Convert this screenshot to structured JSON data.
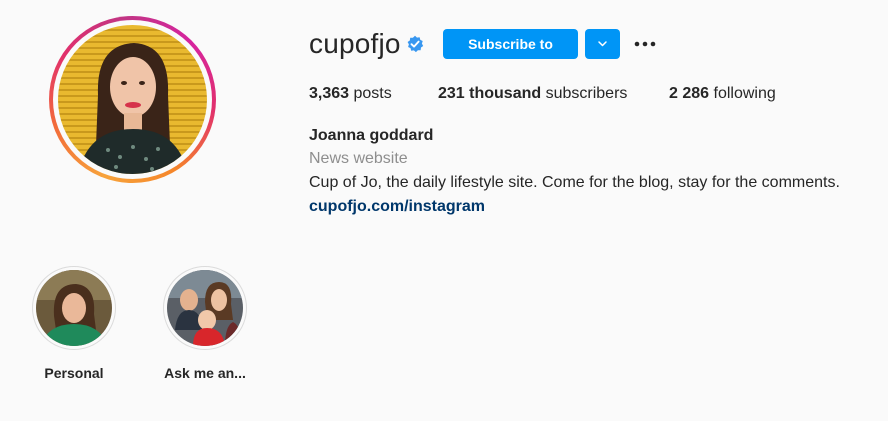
{
  "profile": {
    "username": "cupofjo",
    "verified": true,
    "subscribe_label": "Subscribe to",
    "full_name": "Joanna goddard",
    "category": "News website",
    "bio": "Cup of Jo, the daily lifestyle site. Come for the blog, stay for the comments.",
    "link": "cupofjo.com/instagram"
  },
  "stats": {
    "posts_value": "3,363",
    "posts_label": "posts",
    "subscribers_value": "231 thousand",
    "subscribers_label": "subscribers",
    "following_value": "2 286",
    "following_label": "following"
  },
  "highlights": [
    {
      "label": "Personal"
    },
    {
      "label": "Ask me an..."
    }
  ],
  "icons": {
    "verified": "verified-badge-icon",
    "dropdown": "chevron-down-icon",
    "more": "more-options-icon"
  },
  "colors": {
    "primary_button": "#0095f6",
    "link": "#00376b",
    "muted_text": "#8e8e8e",
    "background": "#fafafa"
  }
}
